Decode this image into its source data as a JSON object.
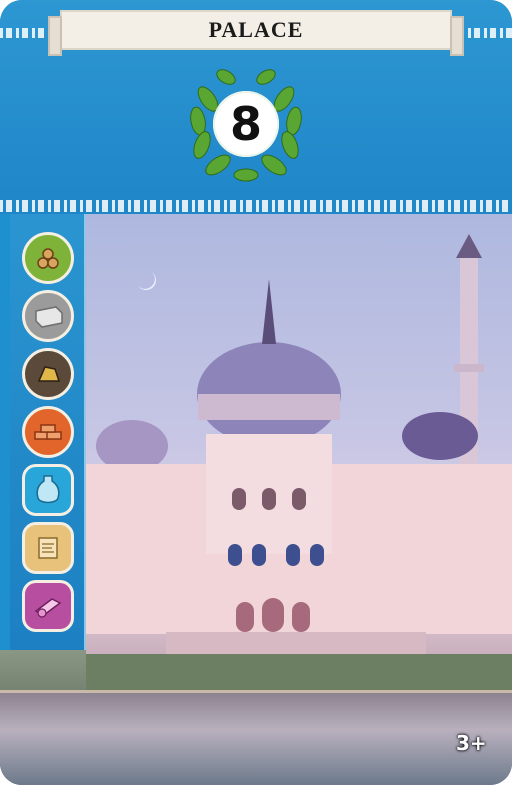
{
  "card": {
    "name": "PALACE",
    "victory_points": "8",
    "player_count": "3+",
    "colors": {
      "header_blue": "#1f86c8",
      "laurel_green": "#5aa632",
      "banner_cream": "#f3efe6"
    }
  },
  "cost": [
    {
      "resource": "wood",
      "icon": "wood-logs-icon",
      "color": "#7fb238"
    },
    {
      "resource": "stone",
      "icon": "stone-block-icon",
      "color": "#8c8c8c"
    },
    {
      "resource": "ore",
      "icon": "ore-icon",
      "color": "#5b4a3a"
    },
    {
      "resource": "clay",
      "icon": "clay-bricks-icon",
      "color": "#e2652b"
    },
    {
      "resource": "glass",
      "icon": "glass-vase-icon",
      "color": "#29a6d9"
    },
    {
      "resource": "papyrus",
      "icon": "papyrus-scroll-icon",
      "color": "#e8c27a"
    },
    {
      "resource": "loom",
      "icon": "loom-cloth-icon",
      "color": "#b84ea0"
    }
  ]
}
